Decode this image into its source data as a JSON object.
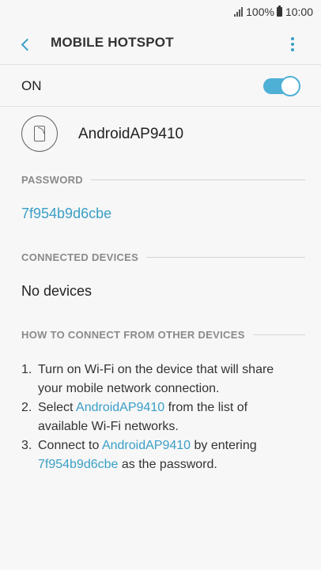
{
  "status_bar": {
    "battery": "100%",
    "time": "10:00"
  },
  "app_bar": {
    "title": "MOBILE HOTSPOT"
  },
  "toggle": {
    "label": "ON",
    "state": "on",
    "accent": "#4fb0d6"
  },
  "network": {
    "name": "AndroidAP9410",
    "icon": "hotspot-phone-icon"
  },
  "password": {
    "header": "PASSWORD",
    "value": "7f954b9d6cbe"
  },
  "connected": {
    "header": "CONNECTED DEVICES",
    "value": "No devices"
  },
  "how_to": {
    "header": "HOW TO CONNECT FROM OTHER DEVICES",
    "step1": {
      "num": "1.",
      "text": "Turn on Wi-Fi on the device that will share your mobile network connection."
    },
    "step2": {
      "num": "2.",
      "pre": "Select ",
      "ssid": "AndroidAP9410",
      "post": " from the list of available Wi-Fi networks."
    },
    "step3": {
      "num": "3.",
      "pre": "Connect to ",
      "ssid": "AndroidAP9410",
      "mid": " by entering ",
      "password": "7f954b9d6cbe",
      "post": " as the password."
    }
  },
  "colors": {
    "accent": "#3a9fc7",
    "background": "#f7f7f7",
    "section_header": "#8a8a8a"
  }
}
